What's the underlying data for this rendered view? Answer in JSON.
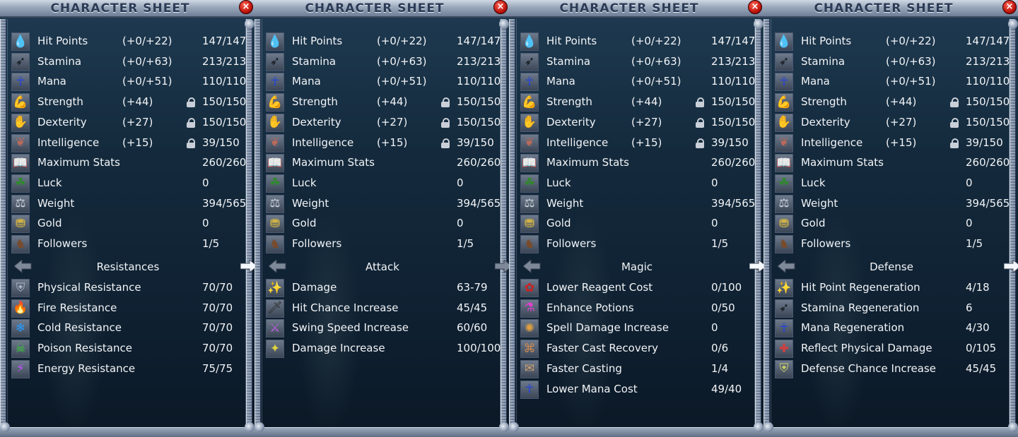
{
  "window_title": "CHARACTER SHEET",
  "close_label": "×",
  "stats": [
    {
      "icon": "blood-drop-icon",
      "glyph": "💧",
      "color": "#d41c10",
      "label": "Hit Points",
      "mod": "(+0/+22)",
      "value": "147/147",
      "lock": false
    },
    {
      "icon": "stamina-icon",
      "glyph": "➶",
      "color": "#101418",
      "label": "Stamina",
      "mod": "(+0/+63)",
      "value": "213/213",
      "lock": false
    },
    {
      "icon": "ankh-icon",
      "glyph": "☥",
      "color": "#2040e0",
      "label": "Mana",
      "mod": "(+0/+51)",
      "value": "110/110",
      "lock": false
    },
    {
      "icon": "flexed-arm-icon",
      "glyph": "💪",
      "color": "#c98a55",
      "label": "Strength",
      "mod": "(+44)",
      "value": "150/150",
      "lock": true
    },
    {
      "icon": "dexterity-icon",
      "glyph": "✋",
      "color": "#c0402a",
      "label": "Dexterity",
      "mod": "(+27)",
      "value": "150/150",
      "lock": true
    },
    {
      "icon": "brain-icon",
      "glyph": "❦",
      "color": "#b86a5a",
      "label": "Intelligence",
      "mod": "(+15)",
      "value": "39/150",
      "lock": true
    },
    {
      "icon": "book-icon",
      "glyph": "📖",
      "color": "#d9b36a",
      "label": "Maximum Stats",
      "mod": "",
      "value": "260/260",
      "lock": false
    },
    {
      "icon": "clover-icon",
      "glyph": "☘",
      "color": "#2f8a2a",
      "label": "Luck",
      "mod": "",
      "value": "0",
      "lock": false
    },
    {
      "icon": "weight-icon",
      "glyph": "⚖",
      "color": "#cfd5dd",
      "label": "Weight",
      "mod": "",
      "value": "394/565",
      "lock": false
    },
    {
      "icon": "gold-coins-icon",
      "glyph": "⛃",
      "color": "#e8c23a",
      "label": "Gold",
      "mod": "",
      "value": "0",
      "lock": false
    },
    {
      "icon": "horse-icon",
      "glyph": "♞",
      "color": "#7a4a2a",
      "label": "Followers",
      "mod": "",
      "value": "1/5",
      "lock": false
    }
  ],
  "panels": [
    {
      "section": "Resistances",
      "left_arrow": "prev-arrow",
      "right_arrow_active": true,
      "items": [
        {
          "icon": "shield-icon",
          "glyph": "⛨",
          "color": "#aab6c6",
          "label": "Physical Resistance",
          "value": "70/70"
        },
        {
          "icon": "fire-icon",
          "glyph": "🔥",
          "color": "#ff6a10",
          "label": "Fire Resistance",
          "value": "70/70"
        },
        {
          "icon": "snowflake-icon",
          "glyph": "❄",
          "color": "#2a9cff",
          "label": "Cold Resistance",
          "value": "70/70"
        },
        {
          "icon": "skull-icon",
          "glyph": "☠",
          "color": "#3cd03c",
          "label": "Poison Resistance",
          "value": "70/70"
        },
        {
          "icon": "energy-icon",
          "glyph": "⚡",
          "color": "#c050ff",
          "label": "Energy Resistance",
          "value": "75/75"
        }
      ]
    },
    {
      "section": "Attack",
      "right_arrow_active": false,
      "items": [
        {
          "icon": "sword-sparkle-icon",
          "glyph": "✨",
          "color": "#e0d040",
          "label": "Damage",
          "value": "63-79"
        },
        {
          "icon": "sword-icon",
          "glyph": "🗡",
          "color": "#2a2a2a",
          "label": "Hit Chance Increase",
          "value": "45/45"
        },
        {
          "icon": "slash-icon",
          "glyph": "⚔",
          "color": "#c060e0",
          "label": "Swing Speed Increase",
          "value": "60/60"
        },
        {
          "icon": "sword-plus-icon",
          "glyph": "✦",
          "color": "#e0d040",
          "label": "Damage Increase",
          "value": "100/100"
        }
      ]
    },
    {
      "section": "Magic",
      "right_arrow_active": true,
      "items": [
        {
          "icon": "reagent-icon",
          "glyph": "✿",
          "color": "#d02020",
          "label": "Lower Reagent Cost",
          "value": "0/100"
        },
        {
          "icon": "potion-icon",
          "glyph": "⚗",
          "color": "#e040d0",
          "label": "Enhance Potions",
          "value": "0/50"
        },
        {
          "icon": "spell-damage-icon",
          "glyph": "✺",
          "color": "#e0a040",
          "label": "Spell Damage Increase",
          "value": "0"
        },
        {
          "icon": "scroll-icon",
          "glyph": "⌘",
          "color": "#d08a50",
          "label": "Faster Cast Recovery",
          "value": "0/6"
        },
        {
          "icon": "scroll-cast-icon",
          "glyph": "✉",
          "color": "#d0a070",
          "label": "Faster Casting",
          "value": "1/4"
        },
        {
          "icon": "ankh-icon",
          "glyph": "☥",
          "color": "#2040e0",
          "label": "Lower Mana Cost",
          "value": "49/40"
        }
      ]
    },
    {
      "section": "Defense",
      "right_arrow_active": true,
      "items": [
        {
          "icon": "sword-sparkle-icon",
          "glyph": "✨",
          "color": "#e0d040",
          "label": "Hit Point Regeneration",
          "value": "4/18"
        },
        {
          "icon": "stamina-icon",
          "glyph": "➶",
          "color": "#101418",
          "label": "Stamina Regeneration",
          "value": "6"
        },
        {
          "icon": "ankh-icon",
          "glyph": "☥",
          "color": "#2040e0",
          "label": "Mana Regeneration",
          "value": "4/30"
        },
        {
          "icon": "reflect-icon",
          "glyph": "✚",
          "color": "#d04040",
          "label": "Reflect Physical Damage",
          "value": "0/105"
        },
        {
          "icon": "defense-shield-icon",
          "glyph": "⛨",
          "color": "#d0d060",
          "label": "Defense Chance Increase",
          "value": "45/45"
        }
      ]
    }
  ]
}
